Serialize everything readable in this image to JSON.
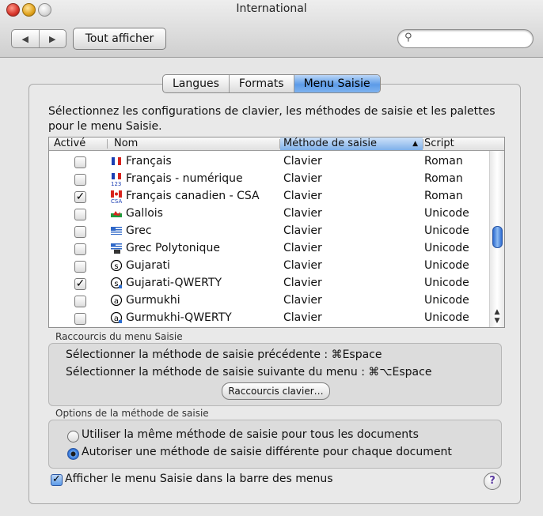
{
  "window": {
    "title": "International",
    "show_all": "Tout afficher",
    "nav_back": "◀",
    "nav_forward": "▶",
    "search_icon": "magnifier-icon"
  },
  "tabs": [
    {
      "label": "Langues",
      "active": false
    },
    {
      "label": "Formats",
      "active": false
    },
    {
      "label": "Menu Saisie",
      "active": true
    }
  ],
  "description": "Sélectionnez les configurations de clavier, les méthodes de saisie et les palettes pour le menu Saisie.",
  "table": {
    "headers": {
      "active": "Activé",
      "name": "Nom",
      "method": "Méthode de saisie",
      "script": "Script"
    },
    "sort_indicator": "▲",
    "rows": [
      {
        "checked": false,
        "name": "Français",
        "method": "Clavier",
        "script": "Roman",
        "flag": "flag-france",
        "flag_label": ""
      },
      {
        "checked": false,
        "name": "Français - numérique",
        "method": "Clavier",
        "script": "Roman",
        "flag": "flag-france-numeric",
        "flag_label": "123"
      },
      {
        "checked": true,
        "name": "Français canadien - CSA",
        "method": "Clavier",
        "script": "Roman",
        "flag": "flag-canada",
        "flag_label": "CSA"
      },
      {
        "checked": false,
        "name": "Gallois",
        "method": "Clavier",
        "script": "Unicode",
        "flag": "flag-wales",
        "flag_label": ""
      },
      {
        "checked": false,
        "name": "Grec",
        "method": "Clavier",
        "script": "Unicode",
        "flag": "flag-greece",
        "flag_label": ""
      },
      {
        "checked": false,
        "name": "Grec Polytonique",
        "method": "Clavier",
        "script": "Unicode",
        "flag": "flag-greece-polytonic",
        "flag_label": ""
      },
      {
        "checked": false,
        "name": "Gujarati",
        "method": "Clavier",
        "script": "Unicode",
        "flag": "gujarati-icon",
        "flag_label": ""
      },
      {
        "checked": true,
        "name": "Gujarati-QWERTY",
        "method": "Clavier",
        "script": "Unicode",
        "flag": "gujarati-qwerty-icon",
        "flag_label": ""
      },
      {
        "checked": false,
        "name": "Gurmukhi",
        "method": "Clavier",
        "script": "Unicode",
        "flag": "gurmukhi-icon",
        "flag_label": ""
      },
      {
        "checked": false,
        "name": "Gurmukhi-QWERTY",
        "method": "Clavier",
        "script": "Unicode",
        "flag": "gurmukhi-qwerty-icon",
        "flag_label": ""
      }
    ]
  },
  "shortcuts": {
    "group_label": "Raccourcis du menu Saisie",
    "previous": "Sélectionner la méthode de saisie précédente : ⌘Espace",
    "next": "Sélectionner la méthode de saisie suivante du menu : ⌘⌥Espace",
    "button": "Raccourcis clavier…"
  },
  "options": {
    "group_label": "Options de la méthode de saisie",
    "same_all": "Utiliser la même méthode de saisie pour tous les documents",
    "per_document": "Autoriser une méthode de saisie différente pour chaque document",
    "selected": "per_document"
  },
  "show_menu": {
    "label": "Afficher le menu Saisie dans la barre des menus",
    "checked": true
  },
  "help": "?"
}
